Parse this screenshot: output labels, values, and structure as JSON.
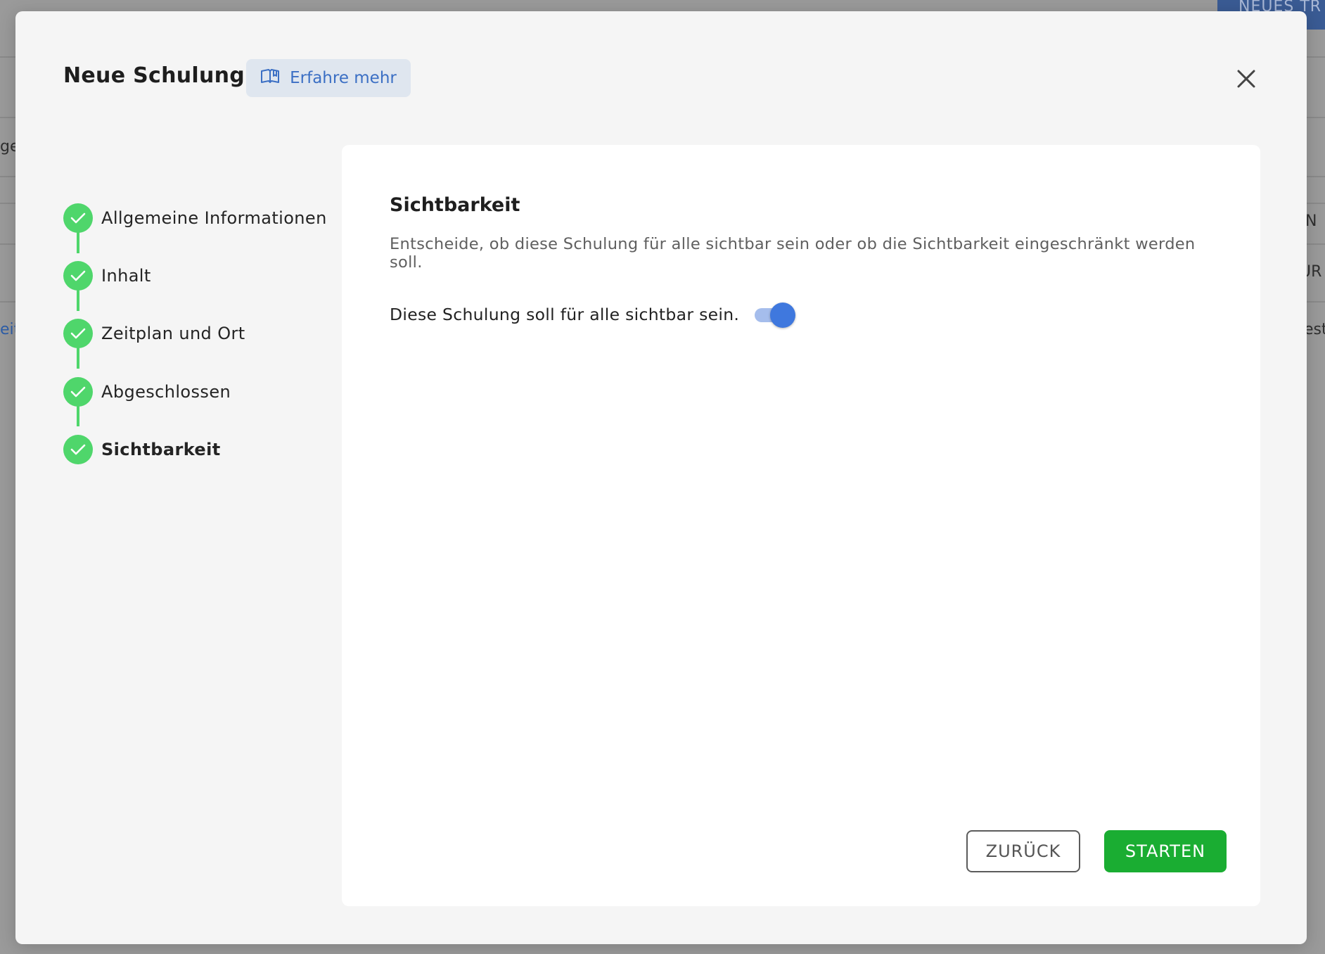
{
  "background": {
    "top_button": "NEUES TR",
    "fragments": [
      "ge",
      "N",
      "UR",
      "eit",
      "est"
    ]
  },
  "modal": {
    "title": "Neue Schulung",
    "learn_more_label": "Erfahre mehr",
    "learn_more_icon": "book-icon",
    "close_icon": "close-icon"
  },
  "stepper": {
    "steps": [
      {
        "label": "Allgemeine Informationen",
        "status": "completed"
      },
      {
        "label": "Inhalt",
        "status": "completed"
      },
      {
        "label": "Zeitplan und Ort",
        "status": "completed"
      },
      {
        "label": "Abgeschlossen",
        "status": "completed"
      },
      {
        "label": "Sichtbarkeit",
        "status": "completed",
        "active": true
      }
    ]
  },
  "content": {
    "title": "Sichtbarkeit",
    "description": "Entscheide, ob diese Schulung für alle sichtbar sein oder ob die Sichtbarkeit eingeschränkt werden soll.",
    "toggle_label": "Diese Schulung soll für alle sichtbar sein.",
    "toggle_on": true
  },
  "actions": {
    "back_label": "ZURÜCK",
    "start_label": "STARTEN"
  },
  "colors": {
    "accent_blue": "#3f78de",
    "success_green": "#1aad32",
    "step_green": "#4fd66b"
  }
}
